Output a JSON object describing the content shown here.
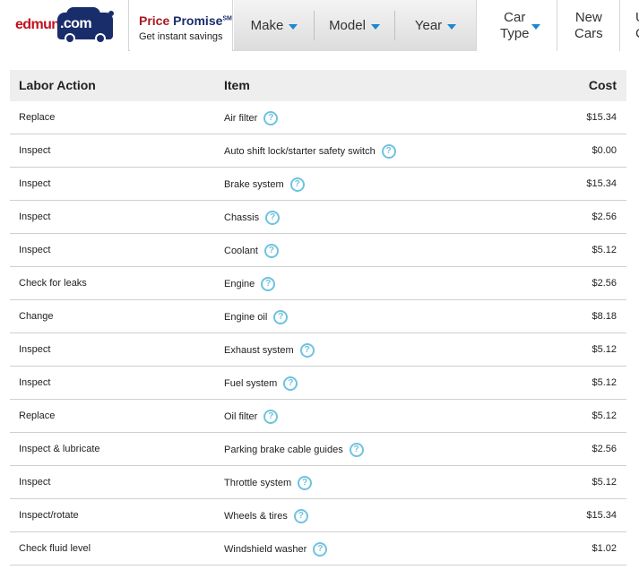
{
  "header": {
    "logo": {
      "word": "edmunds",
      "com": ".com"
    },
    "price_promise": {
      "price": "Price",
      "promise": "Promise",
      "sm": "SM",
      "subtitle": "Get instant savings"
    },
    "nav": [
      {
        "label": "Make"
      },
      {
        "label": "Model"
      },
      {
        "label": "Year"
      }
    ],
    "car_type": {
      "line1": "Car",
      "line2": "Type"
    },
    "new_cars": {
      "line1": "New",
      "line2": "Cars"
    },
    "cutoff": {
      "line1": "U",
      "line2": "C"
    }
  },
  "table": {
    "headers": {
      "action": "Labor Action",
      "item": "Item",
      "cost": "Cost"
    },
    "rows": [
      {
        "action": "Replace",
        "item": "Air filter",
        "cost": "$15.34"
      },
      {
        "action": "Inspect",
        "item": "Auto shift lock/starter safety switch",
        "cost": "$0.00"
      },
      {
        "action": "Inspect",
        "item": "Brake system",
        "cost": "$15.34"
      },
      {
        "action": "Inspect",
        "item": "Chassis",
        "cost": "$2.56"
      },
      {
        "action": "Inspect",
        "item": "Coolant",
        "cost": "$5.12"
      },
      {
        "action": "Check for leaks",
        "item": "Engine",
        "cost": "$2.56"
      },
      {
        "action": "Change",
        "item": "Engine oil",
        "cost": "$8.18"
      },
      {
        "action": "Inspect",
        "item": "Exhaust system",
        "cost": "$5.12"
      },
      {
        "action": "Inspect",
        "item": "Fuel system",
        "cost": "$5.12"
      },
      {
        "action": "Replace",
        "item": "Oil filter",
        "cost": "$5.12"
      },
      {
        "action": "Inspect & lubricate",
        "item": "Parking brake cable guides",
        "cost": "$2.56"
      },
      {
        "action": "Inspect",
        "item": "Throttle system",
        "cost": "$5.12"
      },
      {
        "action": "Inspect/rotate",
        "item": "Wheels & tires",
        "cost": "$15.34"
      },
      {
        "action": "Check fluid level",
        "item": "Windshield washer",
        "cost": "$1.02"
      }
    ],
    "help_icon": "?"
  },
  "colors": {
    "brand_red": "#c0121e",
    "brand_navy": "#1a2d6b",
    "caret_blue": "#1b87d1",
    "help_icon_blue": "#6fc3df",
    "header_row_bg": "#eeeeee"
  }
}
